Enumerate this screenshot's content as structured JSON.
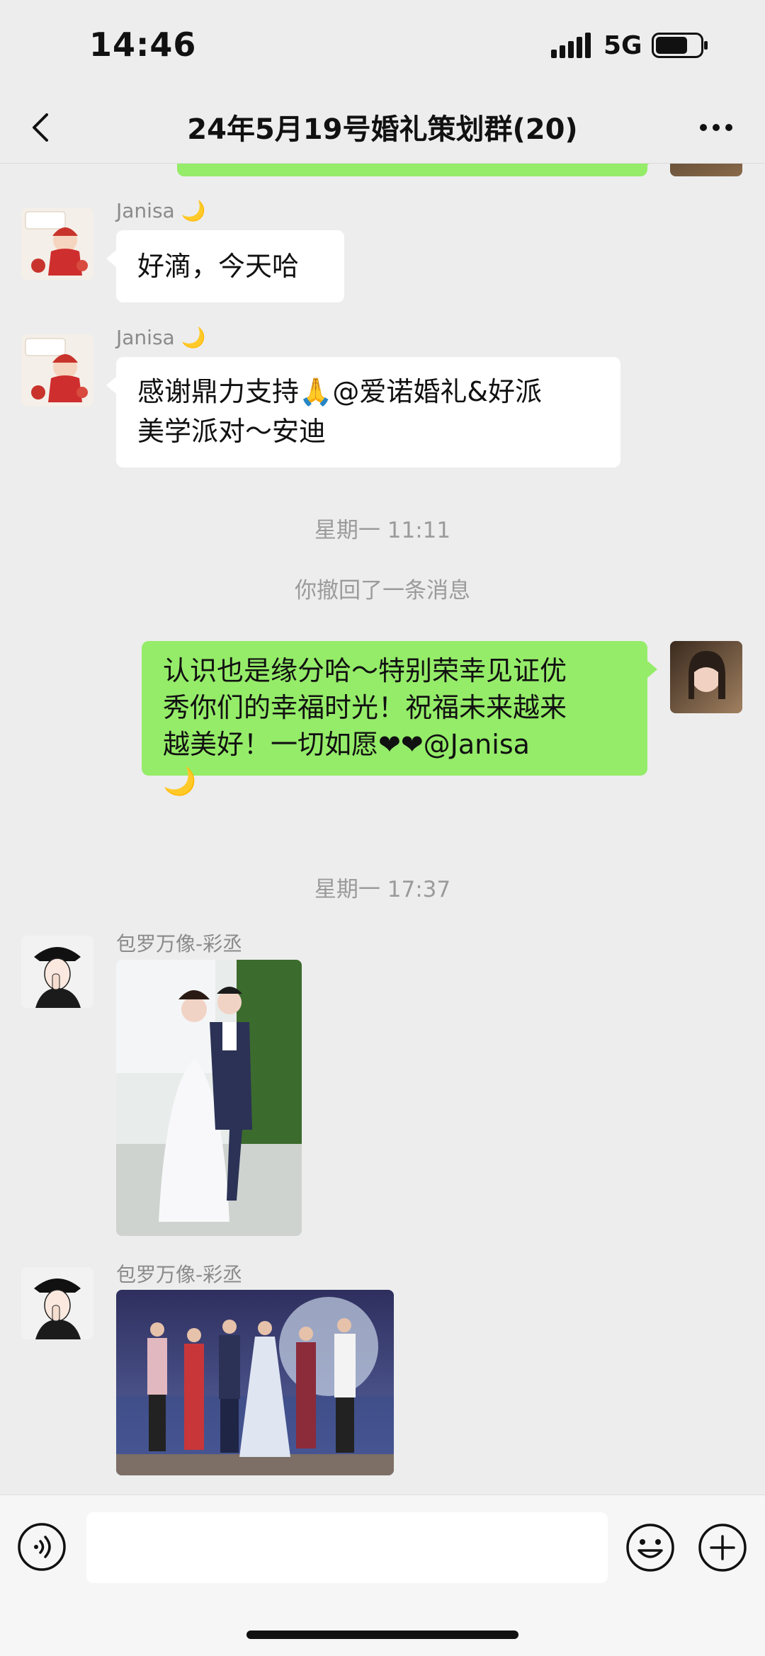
{
  "status_bar": {
    "time": "14:46",
    "network": "5G"
  },
  "header": {
    "title": "24年5月19号婚礼策划群(20)"
  },
  "messages": [
    {
      "sender": "Janisa 🌙",
      "text": "好滴，今天哈"
    },
    {
      "sender": "Janisa 🌙",
      "text_line1": "感谢鼎力支持🙏@爱诺婚礼&好派",
      "text_line2": "美学派对～安迪"
    },
    {
      "time": "星期一 11:11"
    },
    {
      "system": "你撤回了一条消息"
    },
    {
      "text_line1": "认识也是缘分哈～特别荣幸见证优",
      "text_line2": "秀你们的幸福时光！祝福未来越来",
      "text_line3": "越美好！一切如愿❤❤@Janisa",
      "text_line4": "🌙"
    },
    {
      "time": "星期一 17:37"
    },
    {
      "sender": "包罗万像-彩丞"
    },
    {
      "sender": "包罗万像-彩丞"
    }
  ],
  "input": {
    "placeholder": ""
  },
  "colors": {
    "outgoing_bubble": "#95ec69",
    "background": "#ededed"
  }
}
